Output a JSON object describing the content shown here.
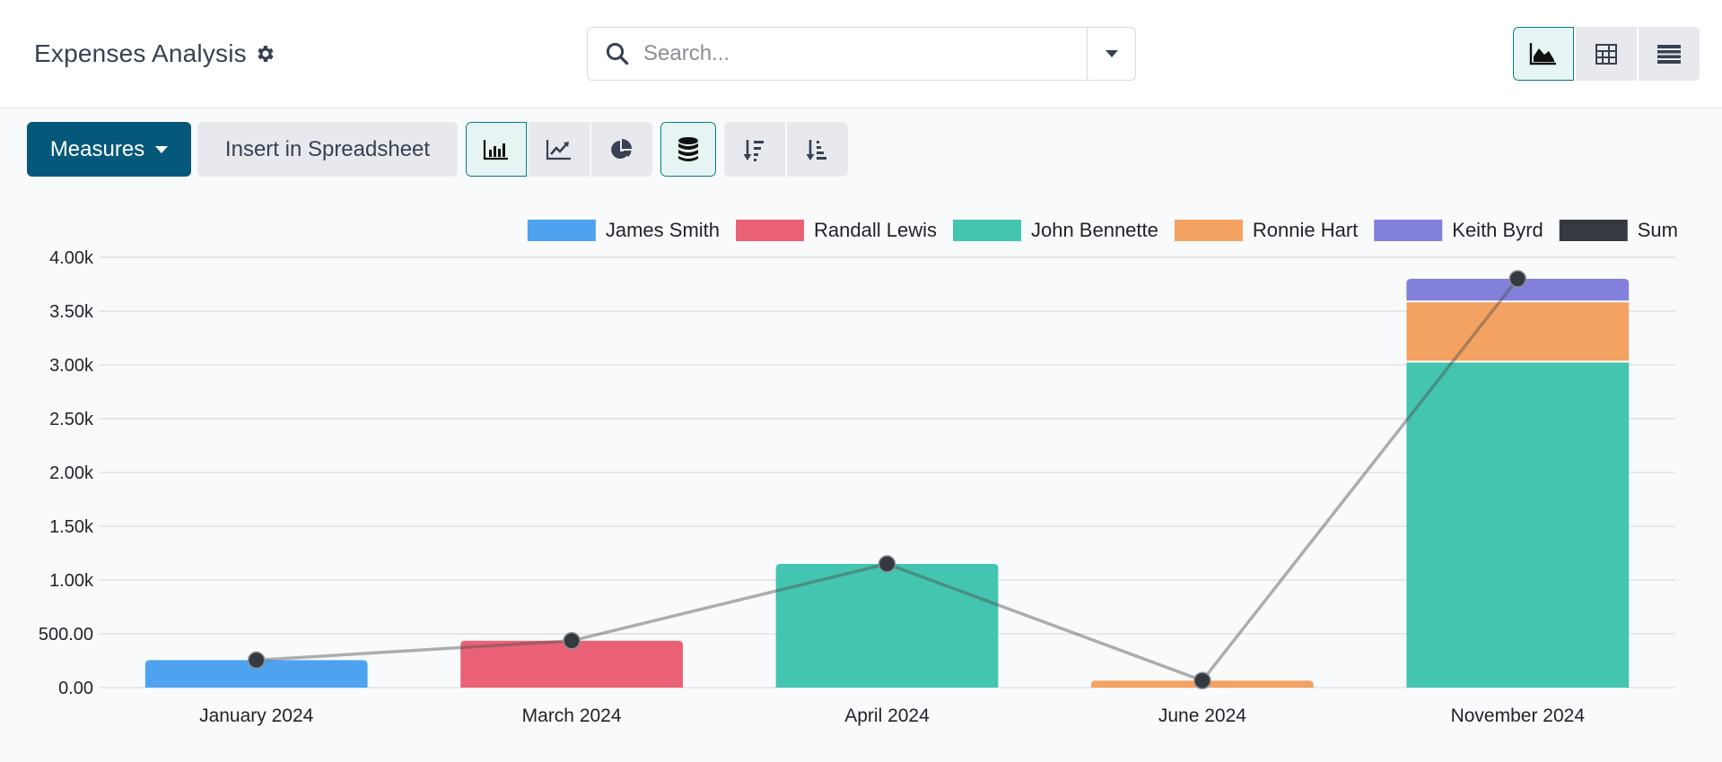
{
  "header": {
    "title": "Expenses Analysis",
    "title_icon": "gear-icon",
    "search": {
      "placeholder": "Search...",
      "value": "",
      "icon": "search-icon",
      "toggle_icon": "caret-down-icon"
    },
    "view_switcher": [
      {
        "name": "graph",
        "icon": "area-chart-icon",
        "active": true
      },
      {
        "name": "pivot",
        "icon": "table-grid-icon",
        "active": false
      },
      {
        "name": "list",
        "icon": "list-icon",
        "active": false
      }
    ]
  },
  "toolbar": {
    "measures_label": "Measures",
    "insert_label": "Insert in Spreadsheet",
    "chart_types": [
      {
        "name": "bar",
        "icon": "bar-chart-icon",
        "active": true
      },
      {
        "name": "line",
        "icon": "line-chart-icon",
        "active": false
      },
      {
        "name": "pie",
        "icon": "pie-chart-icon",
        "active": false
      }
    ],
    "stacked": {
      "icon": "database-stack-icon",
      "active": true
    },
    "sort": [
      {
        "name": "descending",
        "icon": "sort-descending-icon"
      },
      {
        "name": "ascending",
        "icon": "sort-ascending-icon"
      }
    ]
  },
  "colors": {
    "accent": "#05587a",
    "active_border": "#017e84",
    "active_bg": "#e6f4f4"
  },
  "chart_data": {
    "type": "bar",
    "stacked": true,
    "title": "",
    "xlabel": "",
    "ylabel": "",
    "ylim": [
      0,
      4000
    ],
    "grid": true,
    "legend_position": "top-right",
    "categories": [
      "January 2024",
      "March 2024",
      "April 2024",
      "June 2024",
      "November 2024"
    ],
    "y_ticks": [
      "0.00",
      "500.00",
      "1.00k",
      "1.50k",
      "2.00k",
      "2.50k",
      "3.00k",
      "3.50k",
      "4.00k"
    ],
    "y_tick_values": [
      0,
      500,
      1000,
      1500,
      2000,
      2500,
      3000,
      3500,
      4000
    ],
    "series": [
      {
        "name": "James Smith",
        "color": "#4da3ef",
        "values": [
          255,
          0,
          0,
          0,
          0
        ]
      },
      {
        "name": "Randall Lewis",
        "color": "#ea6175",
        "values": [
          0,
          435,
          0,
          0,
          0
        ]
      },
      {
        "name": "John Bennette",
        "color": "#43c5b0",
        "values": [
          0,
          0,
          1150,
          0,
          3030
        ]
      },
      {
        "name": "Ronnie Hart",
        "color": "#f4a261",
        "values": [
          0,
          0,
          0,
          65,
          560
        ]
      },
      {
        "name": "Keith Byrd",
        "color": "#8380db",
        "values": [
          0,
          0,
          0,
          0,
          210
        ]
      }
    ],
    "line_series": {
      "name": "Sum",
      "color": "#343a40",
      "values": [
        255,
        435,
        1150,
        65,
        3800
      ]
    }
  }
}
